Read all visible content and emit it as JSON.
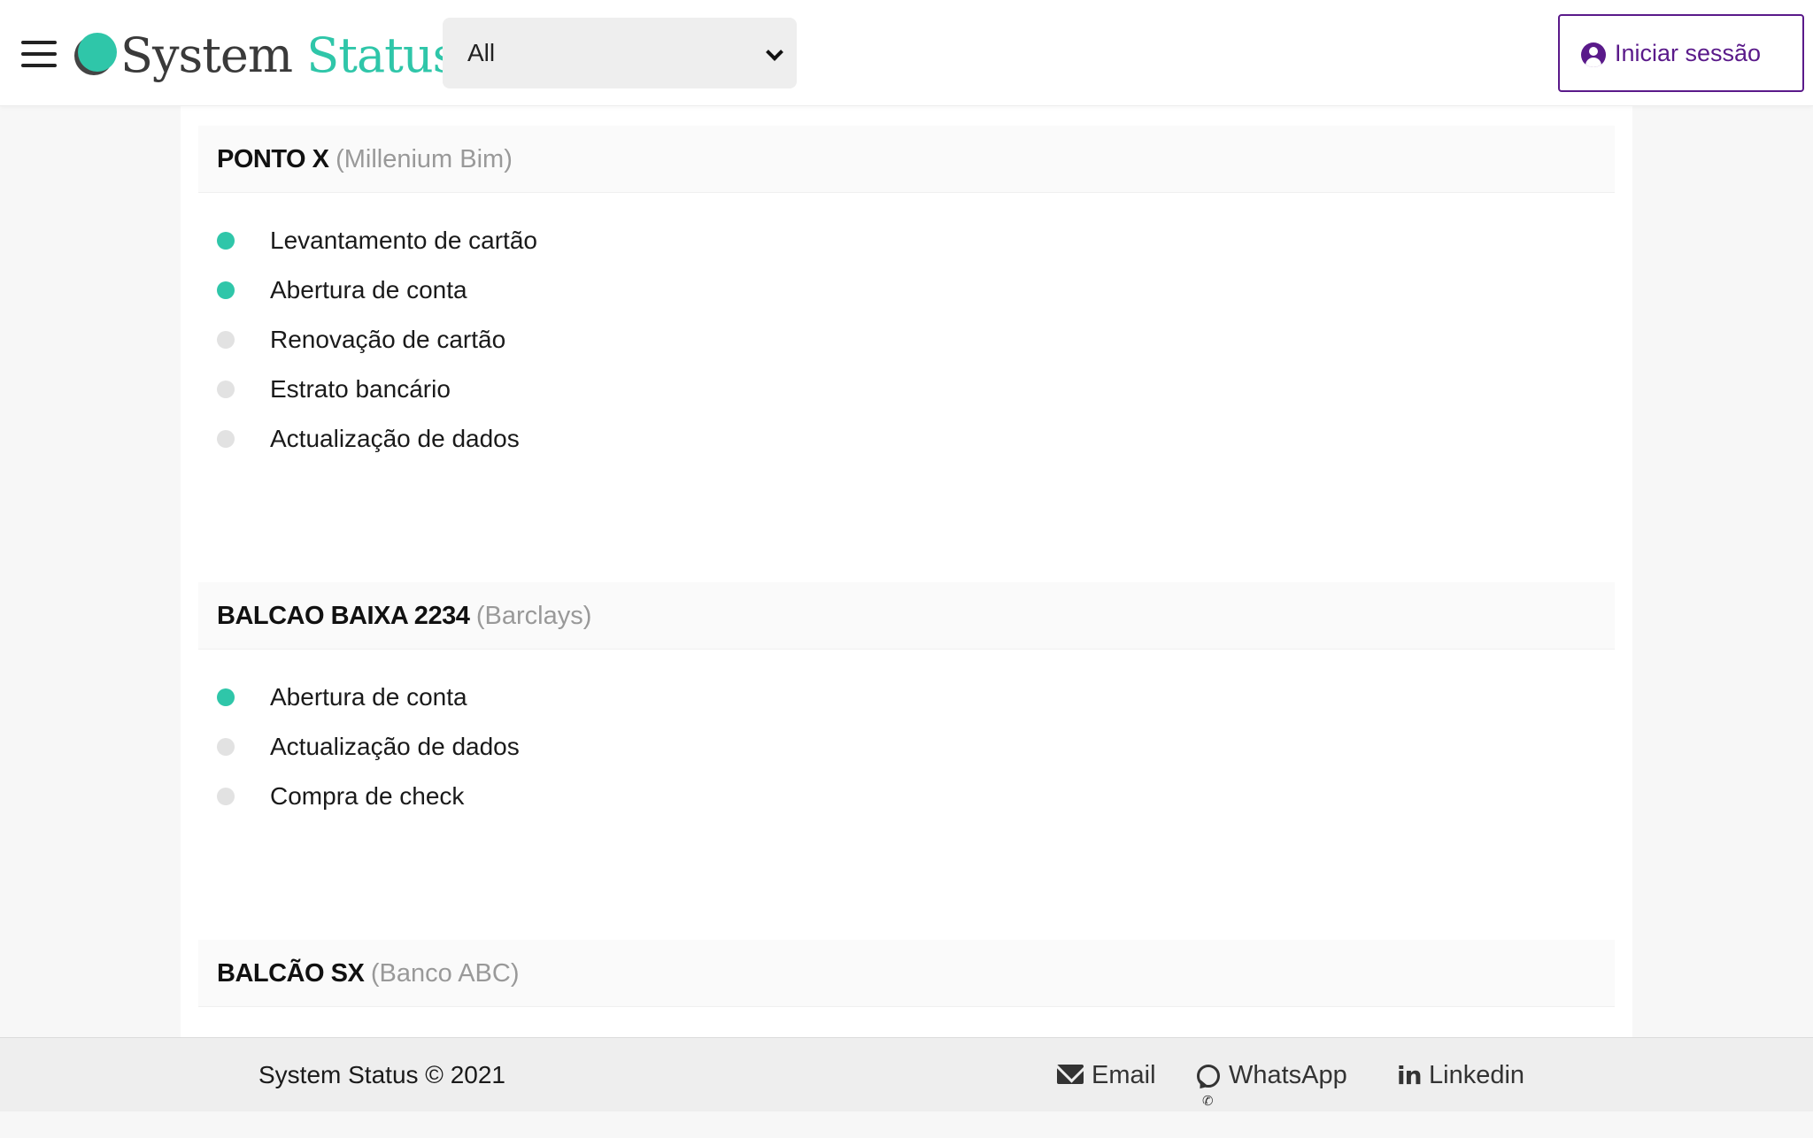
{
  "header": {
    "logo": {
      "word1": "System",
      "word2": "Status"
    },
    "filter": {
      "selected": "All"
    },
    "login_label": "Iniciar sessão"
  },
  "locations": [
    {
      "name": "PONTO X",
      "bank": "(Millenium Bim)",
      "services": [
        {
          "label": "Levantamento de cartão",
          "status": "active"
        },
        {
          "label": "Abertura de conta",
          "status": "active"
        },
        {
          "label": "Renovação de cartão",
          "status": "inactive"
        },
        {
          "label": "Estrato bancário",
          "status": "inactive"
        },
        {
          "label": "Actualização de dados",
          "status": "inactive"
        }
      ]
    },
    {
      "name": "BALCAO BAIXA 2234",
      "bank": "(Barclays)",
      "services": [
        {
          "label": "Abertura de conta",
          "status": "active"
        },
        {
          "label": "Actualização de dados",
          "status": "inactive"
        },
        {
          "label": "Compra de check",
          "status": "inactive"
        }
      ]
    },
    {
      "name": "BALCÃO SX",
      "bank": "(Banco ABC)",
      "services": []
    }
  ],
  "footer": {
    "copyright": "System Status © 2021",
    "links": [
      {
        "label": "Email",
        "icon": "envelope-icon"
      },
      {
        "label": "WhatsApp",
        "icon": "whatsapp-icon"
      },
      {
        "label": "Linkedin",
        "icon": "linkedin-icon"
      }
    ]
  },
  "colors": {
    "accent": "#2fc6a9",
    "inactive": "#e2e2e2",
    "login": "#5a1a8a"
  }
}
